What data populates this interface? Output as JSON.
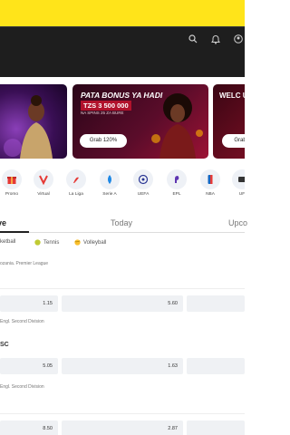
{
  "header": {
    "icons": [
      "search-icon",
      "bell-icon",
      "user-icon"
    ]
  },
  "promos": [
    {
      "id": "promo-1",
      "title": "",
      "amount": "",
      "subtitle": "",
      "button": ""
    },
    {
      "id": "promo-2",
      "title": "PATA BONUS YA HADI",
      "amount": "TZS 3 500 000",
      "subtitle": "NA SPINS 25 ZA BURE",
      "button": "Grab 120%"
    },
    {
      "id": "promo-3",
      "title": "WELC UP T",
      "button": "Grab"
    }
  ],
  "sports": [
    {
      "label": "Promo",
      "icon": "gift-icon",
      "color": "#e53935"
    },
    {
      "label": "Virtual",
      "icon": "v-icon",
      "color": "#e53935"
    },
    {
      "label": "La Liga",
      "icon": "laliga-icon",
      "color": "#e53935"
    },
    {
      "label": "Serie A",
      "icon": "seriea-icon",
      "color": "#1e88e5"
    },
    {
      "label": "UEFA",
      "icon": "uefa-icon",
      "color": "#283593"
    },
    {
      "label": "EPL",
      "icon": "epl-icon",
      "color": "#5e35b1"
    },
    {
      "label": "NBA",
      "icon": "nba-icon",
      "color": "#1565c0"
    },
    {
      "label": "UF",
      "icon": "ufc-icon",
      "color": "#333333"
    }
  ],
  "tabs": [
    {
      "label": "ve"
    },
    {
      "label": "Today"
    },
    {
      "label": "Upco"
    }
  ],
  "filters": [
    {
      "label": "sketball",
      "icon": "basketball-icon",
      "color": "#ff7043"
    },
    {
      "label": "Tennis",
      "icon": "tennis-icon",
      "color": "#c0ca33"
    },
    {
      "label": "Volleyball",
      "icon": "volleyball-icon",
      "color": "#fbc02d"
    }
  ],
  "matches": [
    {
      "league": "ozania. Premier League",
      "team": "",
      "odds": [
        "1.15",
        "5.60",
        ""
      ]
    },
    {
      "league": "Engl. Second Division",
      "team": "SC",
      "odds": [
        "5.05",
        "1.63",
        ""
      ]
    },
    {
      "league": "Engl. Second Division",
      "team": "",
      "odds": [
        "8.50",
        "2.87",
        ""
      ]
    }
  ]
}
